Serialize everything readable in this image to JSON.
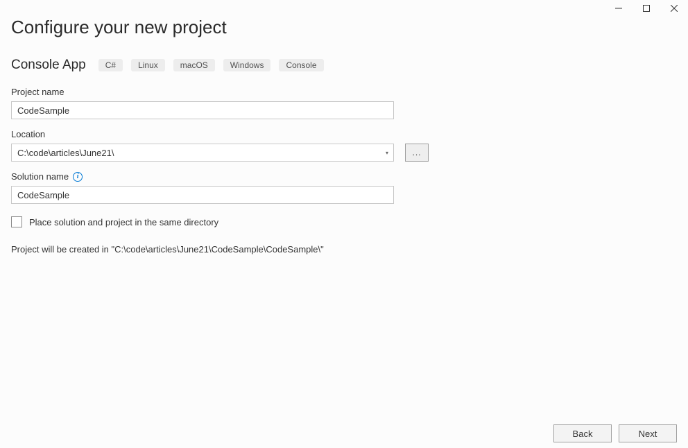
{
  "window": {
    "minimize": "—",
    "maximize": "☐",
    "close": "✕"
  },
  "page": {
    "title": "Configure your new project",
    "subtitle": "Console App",
    "tags": [
      "C#",
      "Linux",
      "macOS",
      "Windows",
      "Console"
    ]
  },
  "fields": {
    "project_name_label": "Project name",
    "project_name_value": "CodeSample",
    "location_label": "Location",
    "location_value": "C:\\code\\articles\\June21\\",
    "browse_label": "...",
    "solution_name_label": "Solution name",
    "solution_name_value": "CodeSample",
    "same_dir_label": "Place solution and project in the same directory"
  },
  "summary": "Project will be created in \"C:\\code\\articles\\June21\\CodeSample\\CodeSample\\\"",
  "footer": {
    "back": "Back",
    "next": "Next"
  }
}
